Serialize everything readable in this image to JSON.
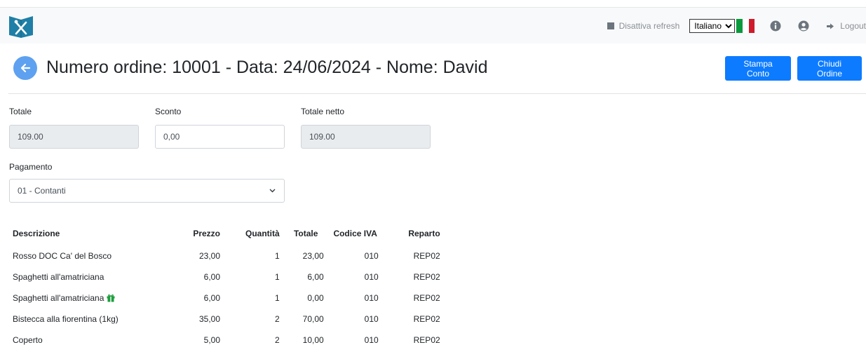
{
  "navbar": {
    "refresh_label": "Disattiva refresh",
    "language_selected": "Italiano",
    "language_options": [
      "Italiano"
    ],
    "flag_colors": [
      "#0a9a3d",
      "#ffffff",
      "#ce1b2b"
    ],
    "logout_label": "Logout",
    "icons": [
      "logo-icon",
      "info-icon",
      "user-icon",
      "logout-icon"
    ]
  },
  "header": {
    "title": "Numero ordine: 10001 - Data: 24/06/2024 - Nome: David",
    "print_button": "Stampa Conto",
    "close_button": "Chiudi Ordine",
    "accent_color": "#0d7bff"
  },
  "form": {
    "totale": {
      "label": "Totale",
      "value": "109.00"
    },
    "sconto": {
      "label": "Sconto",
      "value": "0,00"
    },
    "totale_netto": {
      "label": "Totale netto",
      "value": "109.00"
    },
    "pagamento": {
      "label": "Pagamento",
      "value": "01 - Contanti"
    }
  },
  "table": {
    "headers": {
      "descrizione": "Descrizione",
      "prezzo": "Prezzo",
      "quantita": "Quantità",
      "totale": "Totale",
      "codice_iva": "Codice IVA",
      "reparto": "Reparto"
    },
    "rows": [
      {
        "descrizione": "Rosso DOC Ca' del Bosco",
        "prezzo": "23,00",
        "quantita": "1",
        "totale": "23,00",
        "codice_iva": "010",
        "reparto": "REP02",
        "gift": false
      },
      {
        "descrizione": "Spaghetti all'amatriciana",
        "prezzo": "6,00",
        "quantita": "1",
        "totale": "6,00",
        "codice_iva": "010",
        "reparto": "REP02",
        "gift": false
      },
      {
        "descrizione": "Spaghetti all'amatriciana",
        "prezzo": "6,00",
        "quantita": "1",
        "totale": "0,00",
        "codice_iva": "010",
        "reparto": "REP02",
        "gift": true
      },
      {
        "descrizione": "Bistecca alla fiorentina (1kg)",
        "prezzo": "35,00",
        "quantita": "2",
        "totale": "70,00",
        "codice_iva": "010",
        "reparto": "REP02",
        "gift": false
      },
      {
        "descrizione": "Coperto",
        "prezzo": "5,00",
        "quantita": "2",
        "totale": "10,00",
        "codice_iva": "010",
        "reparto": "REP02",
        "gift": false
      }
    ]
  }
}
